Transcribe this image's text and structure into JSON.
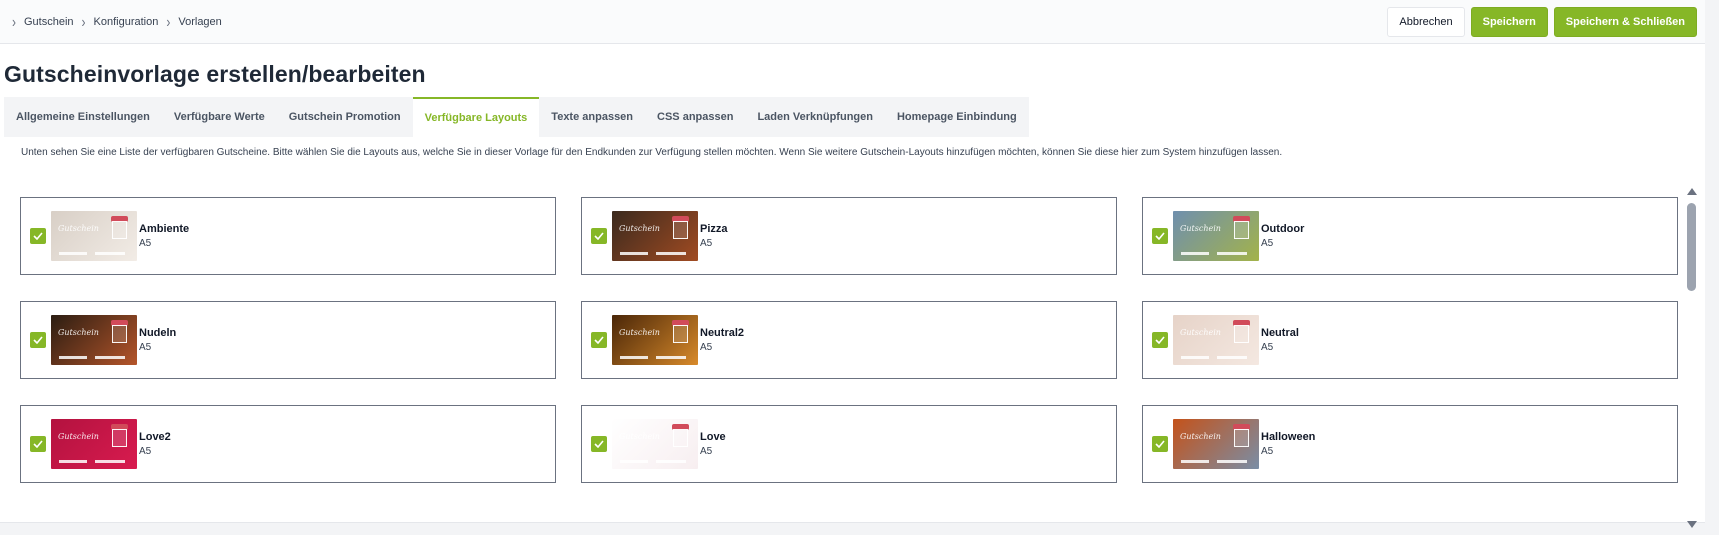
{
  "breadcrumb": [
    "Gutschein",
    "Konfiguration",
    "Vorlagen"
  ],
  "actions": {
    "cancel": "Abbrechen",
    "save": "Speichern",
    "save_close": "Speichern & Schließen"
  },
  "page_title": "Gutscheinvorlage erstellen/bearbeiten",
  "tabs": [
    {
      "label": "Allgemeine Einstellungen",
      "active": false
    },
    {
      "label": "Verfügbare Werte",
      "active": false
    },
    {
      "label": "Gutschein Promotion",
      "active": false
    },
    {
      "label": "Verfügbare Layouts",
      "active": true
    },
    {
      "label": "Texte anpassen",
      "active": false
    },
    {
      "label": "CSS anpassen",
      "active": false
    },
    {
      "label": "Laden Verknüpfungen",
      "active": false
    },
    {
      "label": "Homepage Einbindung",
      "active": false
    }
  ],
  "intro_text": "Unten sehen Sie eine Liste der verfügbaren Gutscheine. Bitte wählen Sie die Layouts aus, welche Sie in dieser Vorlage für den Endkunden zur Verfügung stellen möchten. Wenn Sie weitere Gutschein-Layouts hinzufügen möchten, können Sie diese hier zum System hinzufügen lassen.",
  "layouts": [
    {
      "name": "Ambiente",
      "format": "A5",
      "checked": true,
      "thumb_colors": [
        "#d8cfc6",
        "#f2ece6"
      ]
    },
    {
      "name": "Pizza",
      "format": "A5",
      "checked": true,
      "thumb_colors": [
        "#3b2a1e",
        "#a14b22"
      ]
    },
    {
      "name": "Outdoor",
      "format": "A5",
      "checked": true,
      "thumb_colors": [
        "#6f8fae",
        "#a3b34a"
      ]
    },
    {
      "name": "Nudeln",
      "format": "A5",
      "checked": true,
      "thumb_colors": [
        "#2b1d12",
        "#b5552a"
      ]
    },
    {
      "name": "Neutral2",
      "format": "A5",
      "checked": true,
      "thumb_colors": [
        "#4a2608",
        "#d88a2a"
      ]
    },
    {
      "name": "Neutral",
      "format": "A5",
      "checked": true,
      "thumb_colors": [
        "#e6d3c8",
        "#f4e8e1"
      ]
    },
    {
      "name": "Love2",
      "format": "A5",
      "checked": true,
      "thumb_colors": [
        "#b3123f",
        "#d81b4f"
      ]
    },
    {
      "name": "Love",
      "format": "A5",
      "checked": true,
      "thumb_colors": [
        "#ffffff",
        "#f7eef0"
      ]
    },
    {
      "name": "Halloween",
      "format": "A5",
      "checked": true,
      "thumb_colors": [
        "#c4521a",
        "#7a8ea6"
      ]
    }
  ],
  "thumb_script": "Gutschein",
  "accent_color": "#86b727"
}
